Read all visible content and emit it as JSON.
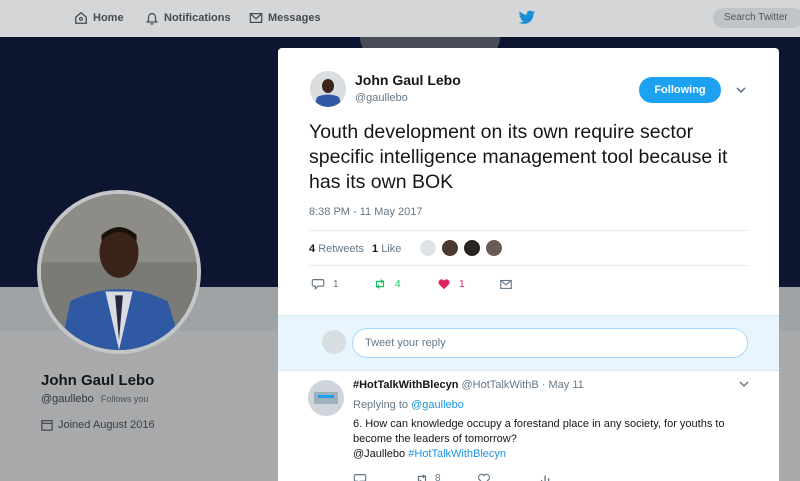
{
  "nav": {
    "home_label": "Home",
    "notifications_label": "Notifications",
    "messages_label": "Messages",
    "search_placeholder": "Search Twitter"
  },
  "profile": {
    "name": "John Gaul Lebo",
    "handle": "@gaullebo",
    "follows_you": "Follows you",
    "joined": "Joined August 2016"
  },
  "tweet": {
    "author_name": "John Gaul Lebo",
    "author_handle": "@gaullebo",
    "follow_button": "Following",
    "text": "Youth development on its own require sector specific intelligence management tool because it has its own BOK",
    "timestamp": "8:38 PM - 11 May 2017",
    "retweets_count": "4",
    "retweets_label": "Retweets",
    "likes_count": "1",
    "likes_label": "Like",
    "reply_count": "1",
    "retweet_count": "4",
    "like_count": "1"
  },
  "reply_box": {
    "placeholder": "Tweet your reply"
  },
  "reply": {
    "name": "#HotTalkWithBlecyn",
    "handle": "@HotTalkWithB",
    "date": "May 11",
    "replying_label": "Replying to",
    "replying_to": "@gaullebo",
    "text": "6. How can knowledge occupy a forestand place in any society, for youths to become the leaders of tomorrow?",
    "mention": "@Jaullebo",
    "hashtag": "#HotTalkWithBlecyn",
    "retweet_count": "8"
  },
  "colors": {
    "accent": "#1da1f2",
    "retweet_green": "#17bf63",
    "like_red": "#e0245e",
    "banner": "#0e1530"
  }
}
